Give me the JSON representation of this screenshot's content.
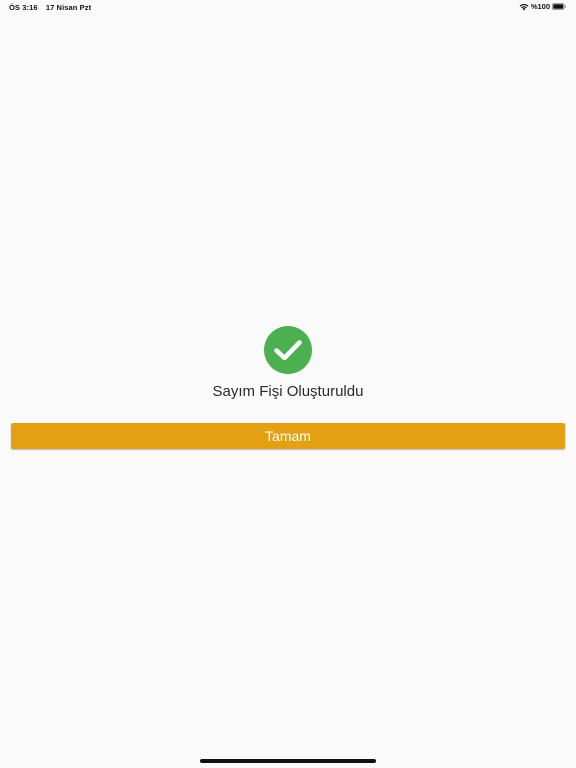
{
  "status_bar": {
    "time": "ÖS 3:16",
    "date": "17 Nisan Pzt",
    "battery": "%100",
    "icons": [
      "wifi-icon",
      "battery-icon"
    ]
  },
  "main": {
    "status_icon": "checkmark-circle-icon",
    "message": "Sayım Fişi Oluşturuldu",
    "ok_button_label": "Tamam"
  },
  "colors": {
    "accent": "#e3a013",
    "success": "#4caf50",
    "background": "#fafafa"
  }
}
